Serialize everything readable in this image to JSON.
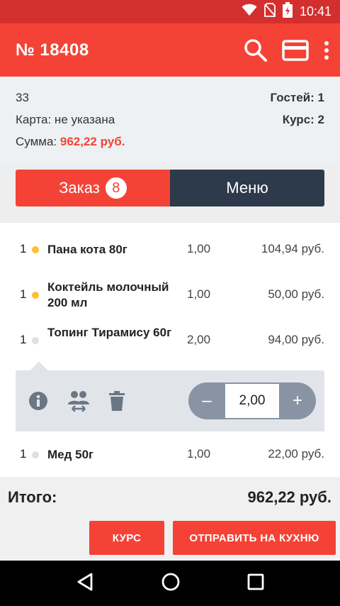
{
  "status_bar": {
    "time": "10:41"
  },
  "header": {
    "title": "№ 18408"
  },
  "info": {
    "table": "33",
    "card_label": "Карта: не указана",
    "sum_label": "Сумма:",
    "sum_value": "962,22  руб.",
    "guests": "Гостей: 1",
    "course": "Курс: 2"
  },
  "tabs": {
    "order_label": "Заказ",
    "order_count": "8",
    "menu_label": "Меню"
  },
  "items": [
    {
      "index": "1",
      "name": "Пана кота  80г",
      "qty": "1,00",
      "price": "104,94  руб.",
      "status": "yellow"
    },
    {
      "index": "1",
      "name": "Коктейль молочный 200 мл",
      "qty": "1,00",
      "price": "50,00  руб.",
      "status": "yellow"
    },
    {
      "index": "1",
      "name": "Топинг Тирамису 60г",
      "qty": "2,00",
      "price": "94,00  руб.",
      "status": "gray"
    },
    {
      "index": "1",
      "name": "Мед 50г",
      "qty": "1,00",
      "price": "22,00  руб.",
      "status": "gray"
    }
  ],
  "editor": {
    "quantity": "2,00",
    "minus": "–",
    "plus": "+"
  },
  "footer": {
    "total_label": "Итого:",
    "total_value": "962,22  руб.",
    "course_button": "КУРС",
    "send_button": "ОТПРАВИТЬ НА КУХНЮ"
  },
  "colors": {
    "accent": "#f44336",
    "status_bar": "#d32f2f",
    "dark_tab": "#2d3a4b"
  },
  "icons": [
    "wifi-icon",
    "no-sim-icon",
    "battery-icon",
    "search-icon",
    "card-icon",
    "more-vert-icon",
    "info-icon",
    "transfer-guests-icon",
    "delete-icon",
    "back-icon",
    "home-icon",
    "recents-icon"
  ]
}
